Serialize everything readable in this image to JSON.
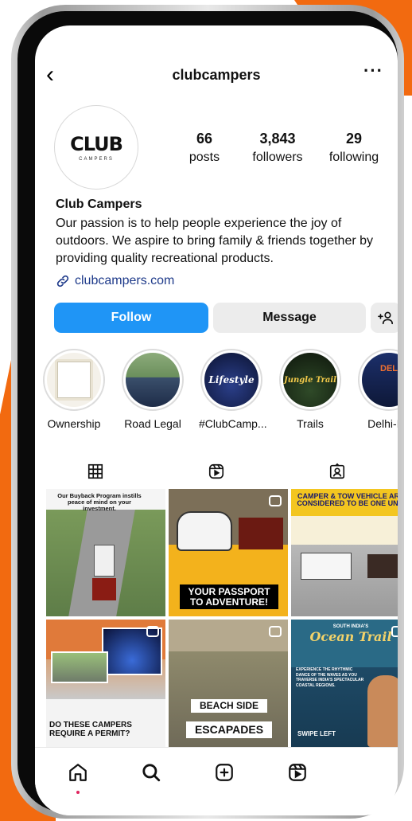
{
  "profile": {
    "username": "clubcampers",
    "posts_count": "66",
    "posts_label": "posts",
    "followers_count": "3,843",
    "followers_label": "followers",
    "following_count": "29",
    "following_label": "following",
    "name": "Club Campers",
    "bio": "Our passion is to help people experience the joy of outdoors. We aspire to bring family & friends together by providing quality recreational products.",
    "website": "clubcampers.com",
    "logo_text": "CLUB",
    "logo_sub": "CAMPERS"
  },
  "actions": {
    "follow": "Follow",
    "message": "Message",
    "add_user": "+⎆"
  },
  "highlights": [
    {
      "label": "Ownership"
    },
    {
      "label": "Road Legal"
    },
    {
      "label": "#ClubCamp..."
    },
    {
      "label": "Trails"
    },
    {
      "label": "Delhi-Ba"
    }
  ],
  "highlight_texts": {
    "lifestyle": "Lifestyle",
    "trail": "Jungle Trail",
    "delhi": "DEL"
  },
  "posts": {
    "p1_caption": "Our Buyback Program instills peace of mind on your investment.",
    "p2_caption": "YOUR PASSPORT TO ADVENTURE!",
    "p3_caption": "CAMPER & TOW VEHICLE ARE CONSIDERED TO BE ONE UNIT",
    "p4_caption": "DO THESE CAMPERS REQUIRE A PERMIT?",
    "p5_caption_1": "BEACH SIDE",
    "p5_caption_2": "ESCAPADES",
    "p6_title_small": "SOUTH INDIA'S",
    "p6_title": "Ocean Trail",
    "p6_body": "EXPERIENCE THE RHYTHMIC DANCE OF THE WAVES AS YOU TRAVERSE INDIA'S SPECTACULAR COASTAL REGIONS.",
    "p6_swipe": "SWIPE LEFT"
  },
  "colors": {
    "accent": "#1f95f6",
    "brand_orange": "#f26a10"
  }
}
